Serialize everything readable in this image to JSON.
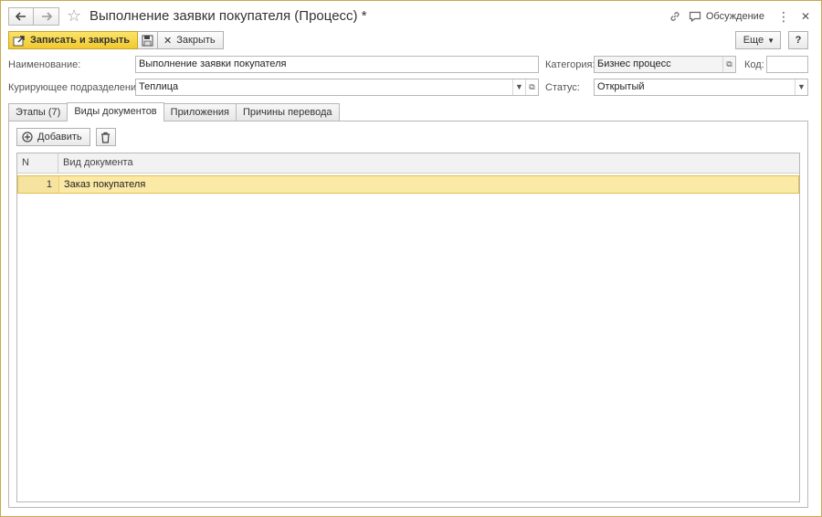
{
  "window": {
    "title": "Выполнение заявки покупателя (Процесс) *",
    "discussion_label": "Обсуждение"
  },
  "toolbar": {
    "save_close_label": "Записать и закрыть",
    "close_label": "Закрыть",
    "more_label": "Еще",
    "help_label": "?"
  },
  "form": {
    "name_label": "Наименование:",
    "name_value": "Выполнение заявки покупателя",
    "category_label": "Категория:",
    "category_value": "Бизнес процесс",
    "code_label": "Код:",
    "code_value": "",
    "department_label": "Курирующее подразделение:",
    "department_value": "Теплица",
    "status_label": "Статус:",
    "status_value": "Открытый"
  },
  "tabs": [
    {
      "label": "Этапы (7)",
      "active": false
    },
    {
      "label": "Виды документов",
      "active": true
    },
    {
      "label": "Приложения",
      "active": false
    },
    {
      "label": "Причины перевода",
      "active": false
    }
  ],
  "panel": {
    "add_label": "Добавить"
  },
  "table": {
    "columns": [
      "N",
      "Вид документа"
    ],
    "rows": [
      {
        "n": "1",
        "doc": "Заказ покупателя",
        "selected": true
      }
    ]
  },
  "colors": {
    "accent": "#f2c92d",
    "selection": "#fbe9a6",
    "window_border": "#c9a94e"
  }
}
